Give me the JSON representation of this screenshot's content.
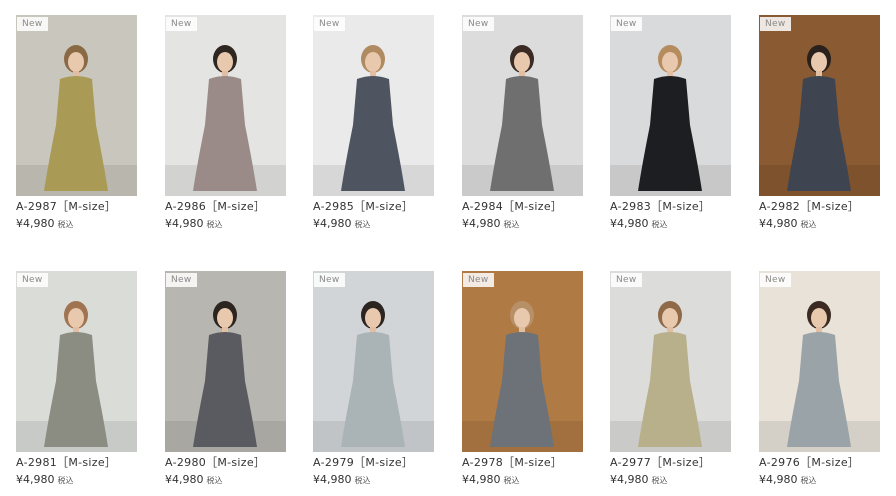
{
  "products": [
    {
      "badge": "New",
      "name": "A-2987［M-size］",
      "price": "¥4,980",
      "tax": "税込",
      "bg": "#c9c6bd",
      "dress": "#a99a55",
      "hair": "#8a6a45"
    },
    {
      "badge": "New",
      "name": "A-2986［M-size］",
      "price": "¥4,980",
      "tax": "税込",
      "bg": "#e4e4e2",
      "dress": "#9a8a88",
      "hair": "#2e2620"
    },
    {
      "badge": "New",
      "name": "A-2985［M-size］",
      "price": "¥4,980",
      "tax": "税込",
      "bg": "#eaeaea",
      "dress": "#4e5560",
      "hair": "#b08a60"
    },
    {
      "badge": "New",
      "name": "A-2984［M-size］",
      "price": "¥4,980",
      "tax": "税込",
      "bg": "#dcdcdc",
      "dress": "#6f6f70",
      "hair": "#3a2c24"
    },
    {
      "badge": "New",
      "name": "A-2983［M-size］",
      "price": "¥4,980",
      "tax": "税込",
      "bg": "#d9dadb",
      "dress": "#1d1e22",
      "hair": "#b58c5d"
    },
    {
      "badge": "New",
      "name": "A-2982［M-size］",
      "price": "¥4,980",
      "tax": "税込",
      "bg": "#8a5a32",
      "dress": "#3e4550",
      "hair": "#2a211c"
    },
    {
      "badge": "New",
      "name": "A-2981［M-size］",
      "price": "¥4,980",
      "tax": "税込",
      "bg": "#dadcd8",
      "dress": "#8b8d82",
      "hair": "#a07450"
    },
    {
      "badge": "New",
      "name": "A-2980［M-size］",
      "price": "¥4,980",
      "tax": "税込",
      "bg": "#b8b6b0",
      "dress": "#5a5b60",
      "hair": "#2c241f"
    },
    {
      "badge": "New",
      "name": "A-2979［M-size］",
      "price": "¥4,980",
      "tax": "税込",
      "bg": "#d2d5d8",
      "dress": "#aab3b5",
      "hair": "#2b2420"
    },
    {
      "badge": "New",
      "name": "A-2978［M-size］",
      "price": "¥4,980",
      "tax": "税込",
      "bg": "#b07a45",
      "dress": "#6c7278",
      "hair": "#b89068"
    },
    {
      "badge": "New",
      "name": "A-2977［M-size］",
      "price": "¥4,980",
      "tax": "税込",
      "bg": "#dcdcda",
      "dress": "#b8b08a",
      "hair": "#8f6a48"
    },
    {
      "badge": "New",
      "name": "A-2976［M-size］",
      "price": "¥4,980",
      "tax": "税込",
      "bg": "#e8e2d8",
      "dress": "#9aa3a8",
      "hair": "#3a2a22"
    }
  ]
}
